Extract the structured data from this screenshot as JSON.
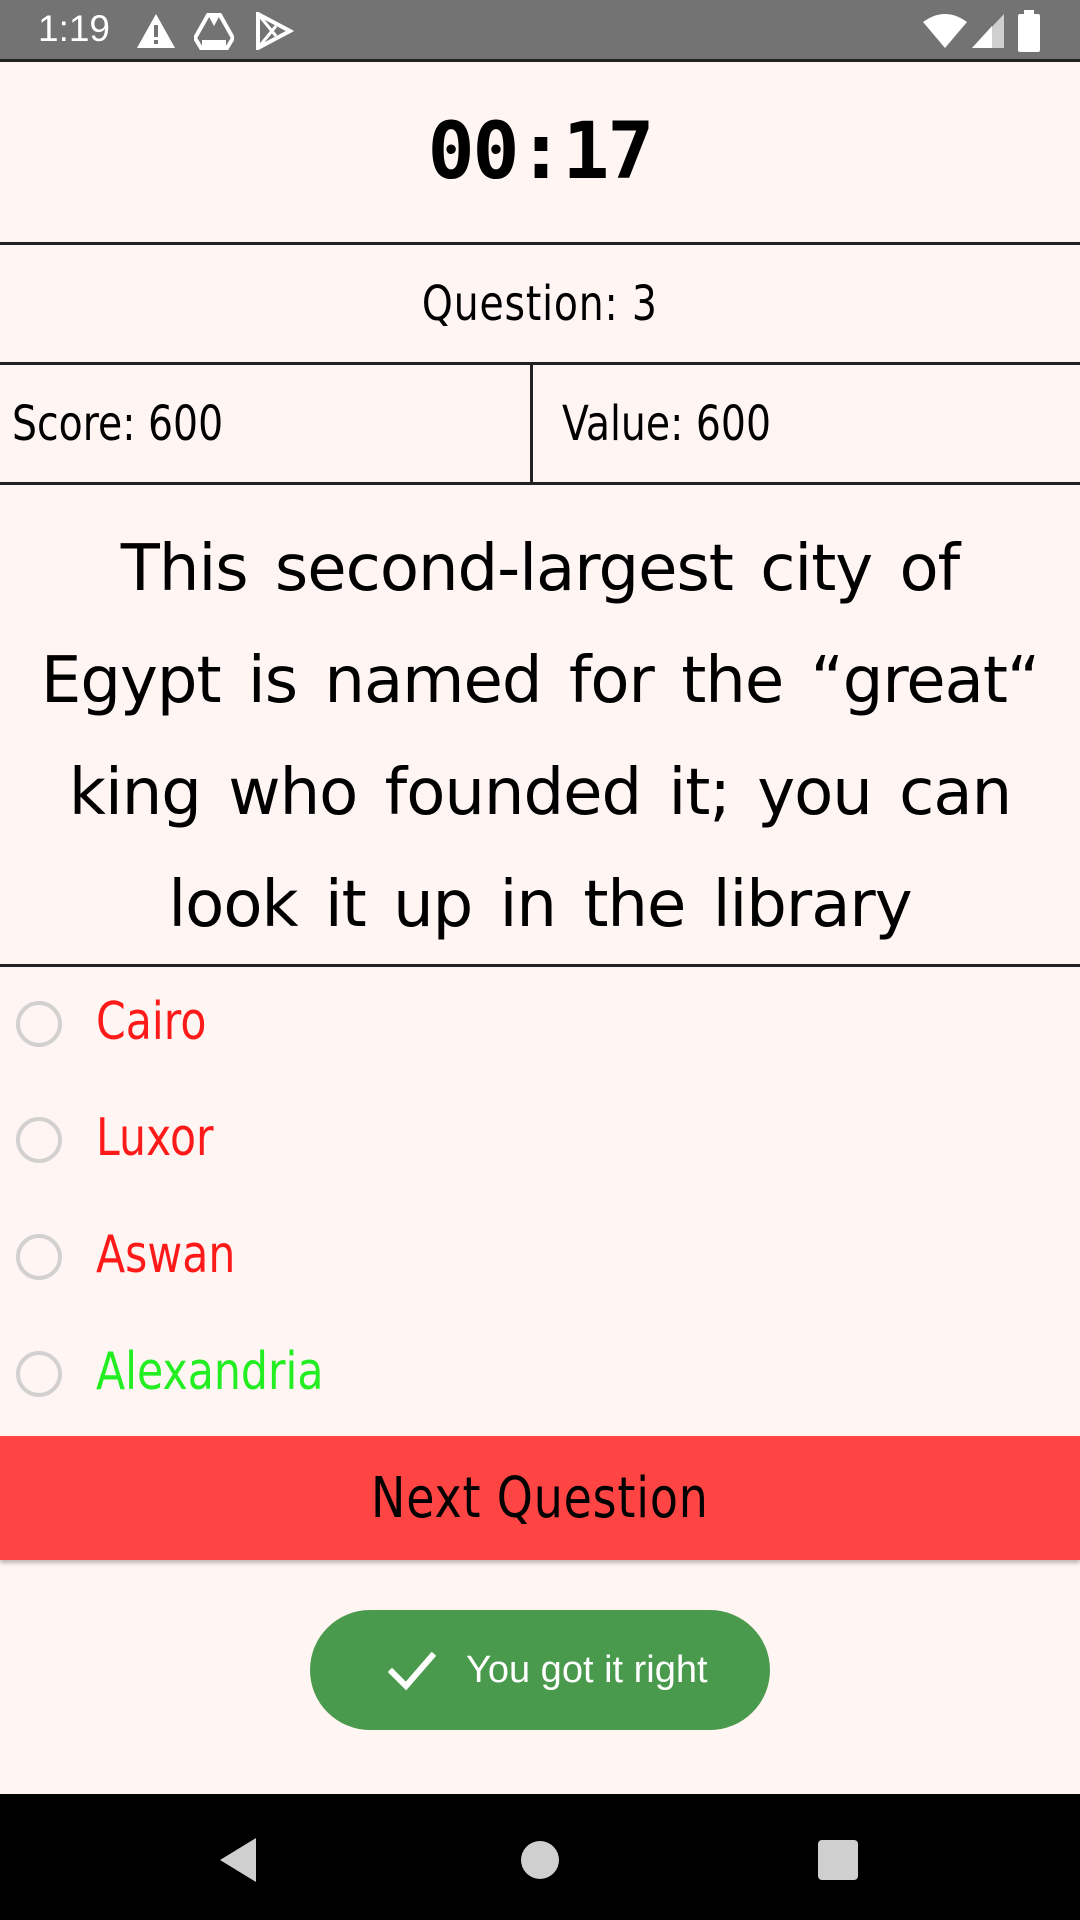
{
  "status_bar": {
    "time": "1:19",
    "icons": [
      "warning-icon",
      "drive-icon",
      "play-store-icon",
      "wifi-icon",
      "signal-icon",
      "battery-icon"
    ]
  },
  "quiz": {
    "timer": "00:17",
    "question_label": "Question: 3",
    "score_label": "Score: 600",
    "value_label": "Value: 600",
    "clue": "This second-largest city of Egypt is named for the “great“ king who founded it; you can look it up in the library",
    "options": [
      {
        "label": "Cairo",
        "color": "#ff1a1a"
      },
      {
        "label": "Luxor",
        "color": "#ff1a1a"
      },
      {
        "label": "Aswan",
        "color": "#ff1a1a"
      },
      {
        "label": "Alexandria",
        "color": "#22ee22"
      }
    ],
    "next_button_label": "Next Question",
    "next_button_color": "#ff4444"
  },
  "toast": {
    "message": "You got it right",
    "icon": "checkmark-icon",
    "color": "#4a9a4e"
  },
  "nav_bar": {
    "buttons": [
      "back-icon",
      "home-icon",
      "recents-icon"
    ]
  }
}
